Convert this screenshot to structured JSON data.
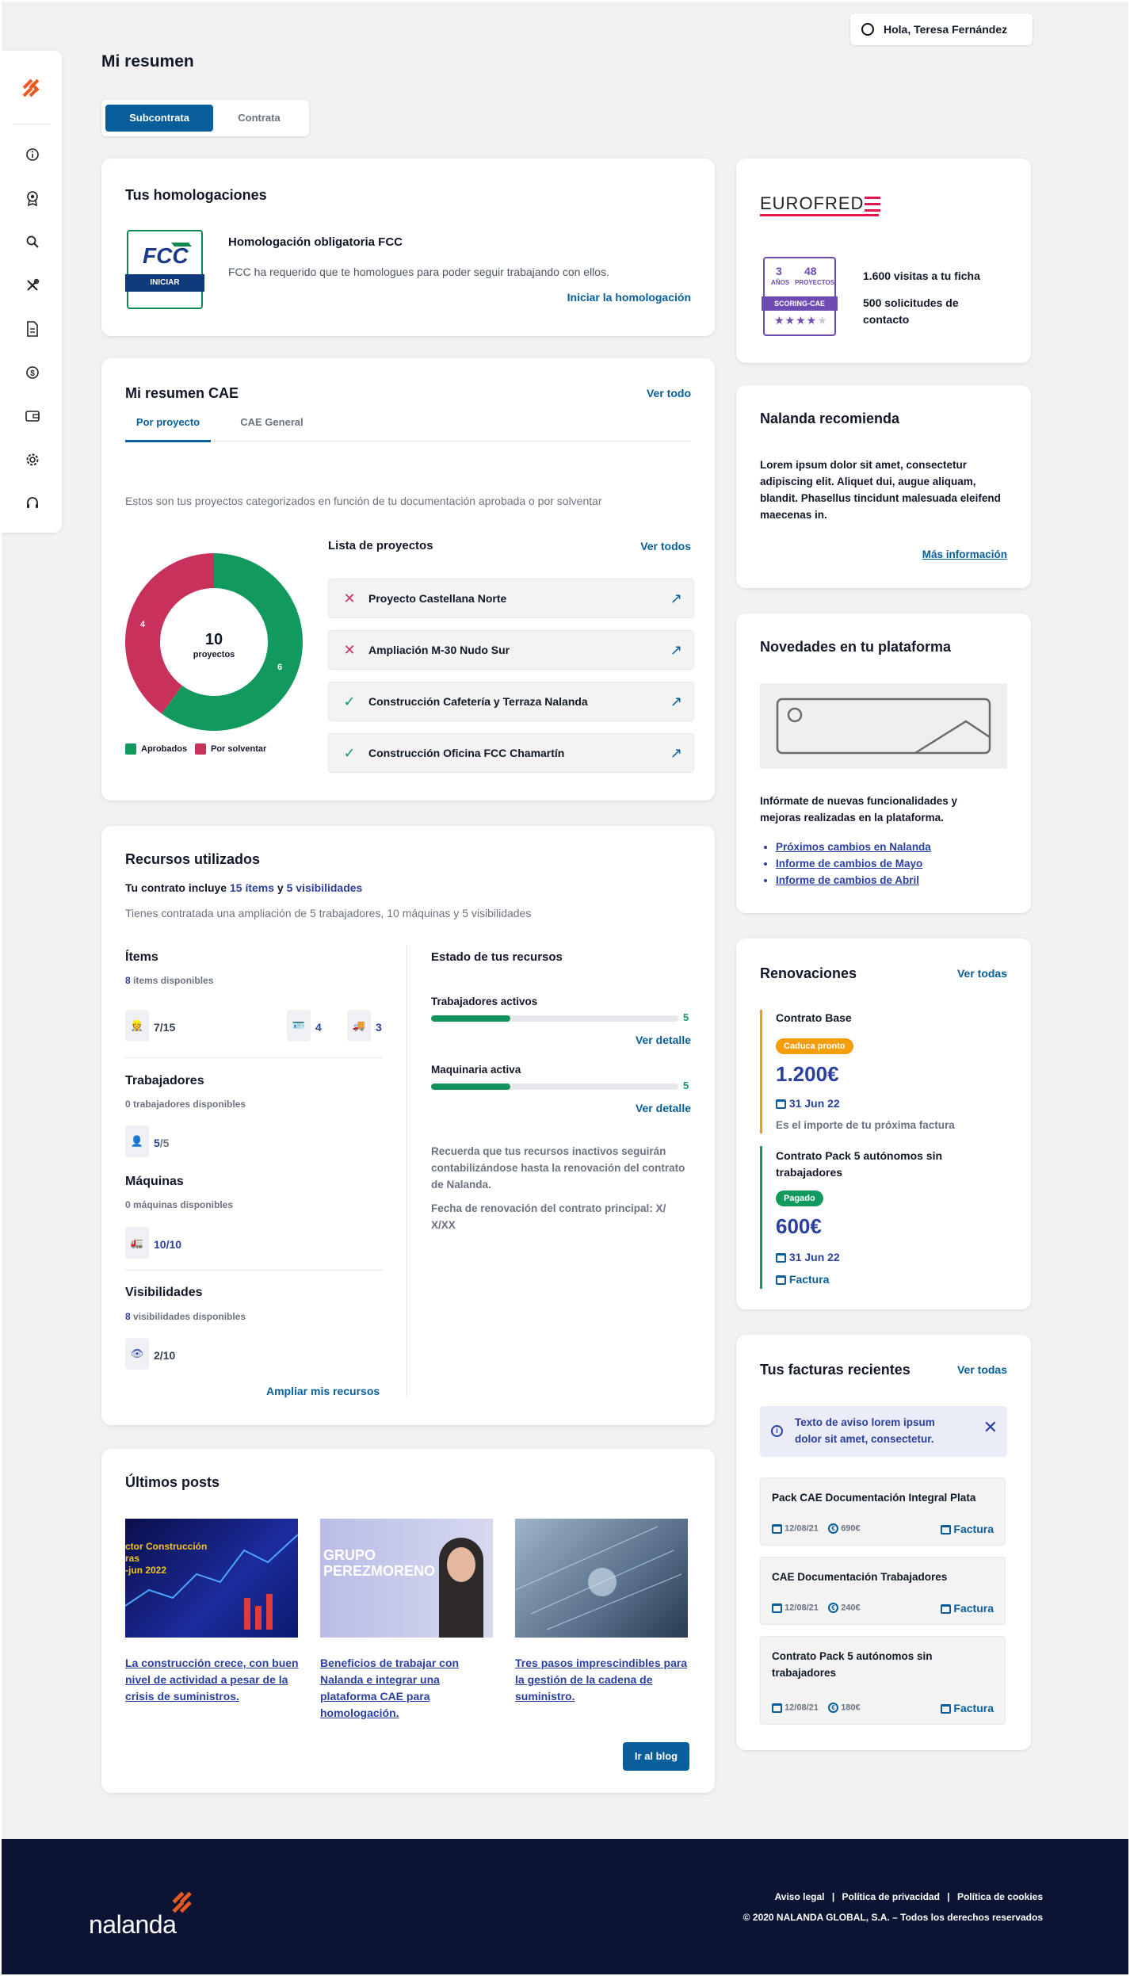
{
  "header": {
    "greeting": "Hola, Teresa Fernández"
  },
  "page_title": "Mi resumen",
  "tabs": {
    "active": "Subcontrata",
    "inactive": "Contrata"
  },
  "homologaciones": {
    "title": "Tus homologaciones",
    "badge_label": "INICIAR",
    "item_title": "Homologación obligatoria FCC",
    "item_text": "FCC ha requerido que te homologues para poder seguir trabajando con ellos.",
    "cta": "Iniciar la homologación"
  },
  "eurofred": {
    "logo": "EUROFRED",
    "years": "3",
    "years_label": "AÑOS",
    "projects": "48",
    "projects_label": "PROYECTOS",
    "scoring_label": "SCORING-CAE",
    "stars": "★★★★★",
    "rating": 4,
    "visits": "1.600 visitas a tu ficha",
    "requests": "500 solicitudes de contacto"
  },
  "cae": {
    "title": "Mi resumen CAE",
    "see_all": "Ver todo",
    "tab_active": "Por proyecto",
    "tab_inactive": "CAE General",
    "description": "Estos son tus proyectos categorizados en función de tu documentación aprobada o por solventar",
    "donut_total": "10",
    "donut_total_label": "proyectos",
    "approved_value": "6",
    "pending_value": "4",
    "legend_approved": "Aprobados",
    "legend_pending": "Por solventar",
    "color_approved": "#12995e",
    "color_pending": "#c8315a",
    "list_title": "Lista de proyectos",
    "list_link": "Ver todos",
    "projects": [
      {
        "name": "Proyecto Castellana Norte",
        "status": "pending"
      },
      {
        "name": "Ampliación M-30 Nudo Sur",
        "status": "pending"
      },
      {
        "name": "Construcción Cafetería y Terraza Nalanda",
        "status": "approved"
      },
      {
        "name": "Construcción Oficina FCC Chamartín",
        "status": "approved"
      }
    ]
  },
  "recursos": {
    "title": "Recursos utilizados",
    "contract_prefix": "Tu contrato incluye",
    "contract_items": "15 ítems",
    "contract_and": "y",
    "contract_visib": "5 visibilidades",
    "extension": "Tienes contratada una ampliación de 5 trabajadores, 10 máquinas y 5 visibilidades",
    "items_title": "Ítems",
    "items_available_num": "8",
    "items_available": "ítems disponibles",
    "items_a": "7/15",
    "items_b": "4",
    "items_c": "3",
    "workers_title": "Trabajadores",
    "workers_available": "0 trabajadores disponibles",
    "workers_value_a": "5",
    "workers_value_b": "/5",
    "machines_title": "Máquinas",
    "machines_available": "0 máquinas disponibles",
    "machines_value": "10/10",
    "visib_title": "Visibilidades",
    "visib_available_num": "8",
    "visib_available": "visibilidades disponibles",
    "visib_value": "2/10",
    "expand": "Ampliar mis recursos",
    "state_title": "Estado de tus recursos",
    "active_workers": "Trabajadores activos",
    "active_workers_value": "5",
    "active_workers_fill": 0.32,
    "active_machines": "Maquinaria activa",
    "active_machines_value": "5",
    "active_machines_fill": 0.32,
    "see_detail": "Ver detalle",
    "note1": "Recuerda que tus recursos inactivos seguirán contabilizándose hasta la renovación del contrato de Nalanda.",
    "note2": "Fecha de renovación del contrato principal: X/ X/XX"
  },
  "recomienda": {
    "title": "Nalanda recomienda",
    "text": "Lorem ipsum dolor sit amet, consectetur adipiscing elit. Aliquet dui, augue aliquam, blandit. Phasellus tincidunt malesuada eleifend maecenas in.",
    "link": "Más información"
  },
  "novedades": {
    "title": "Novedades en tu plataforma",
    "text": "Infórmate de nuevas funcionalidades y mejoras realizadas en la plataforma.",
    "links": [
      "Próximos cambios en Nalanda",
      "Informe de cambios de Mayo",
      "Informe de cambios de Abril"
    ]
  },
  "renovaciones": {
    "title": "Renovaciones",
    "see_all": "Ver todas",
    "item1_name": "Contrato Base",
    "item1_badge": "Caduca pronto",
    "item1_amount": "1.200€",
    "item1_date": "31 Jun 22",
    "item1_note": "Es el importe de tu próxima factura",
    "item2_name": "Contrato Pack 5 autónomos sin trabajadores",
    "item2_badge": "Pagado",
    "item2_amount": "600€",
    "item2_date": "31 Jun 22",
    "item2_invoice": "Factura"
  },
  "facturas": {
    "title": "Tus facturas recientes",
    "see_all": "Ver todas",
    "notice": "Texto de aviso lorem ipsum dolor sit amet, consectetur.",
    "invoice_label": "Factura",
    "items": [
      {
        "name": "Pack CAE Documentación Integral Plata",
        "date": "12/08/21",
        "amount": "690€"
      },
      {
        "name": "CAE Documentación Trabajadores",
        "date": "12/08/21",
        "amount": "240€"
      },
      {
        "name": "Contrato Pack 5 autónomos sin trabajadores",
        "date": "12/08/21",
        "amount": "180€"
      }
    ]
  },
  "posts": {
    "title": "Últimos posts",
    "img1_text": "ctor Construcción\nras\n-jun 2022",
    "img2_text": "GRUPO\nPEREZMORENO",
    "items": [
      "La construcción crece, con buen nivel de actividad a pesar de la crisis de suministros.",
      "Beneficios de trabajar con Nalanda e integrar una plataforma CAE para homologación.",
      "Tres pasos imprescindibles para la gestión de la cadena de suministro."
    ],
    "cta": "Ir al blog"
  },
  "footer": {
    "brand": "nalanda",
    "link1": "Aviso legal",
    "link2": "Política de privacidad",
    "link3": "Política de cookies",
    "sep": "|",
    "copyright": "© 2020 NALANDA GLOBAL, S.A. – Todos los derechos reservados"
  }
}
